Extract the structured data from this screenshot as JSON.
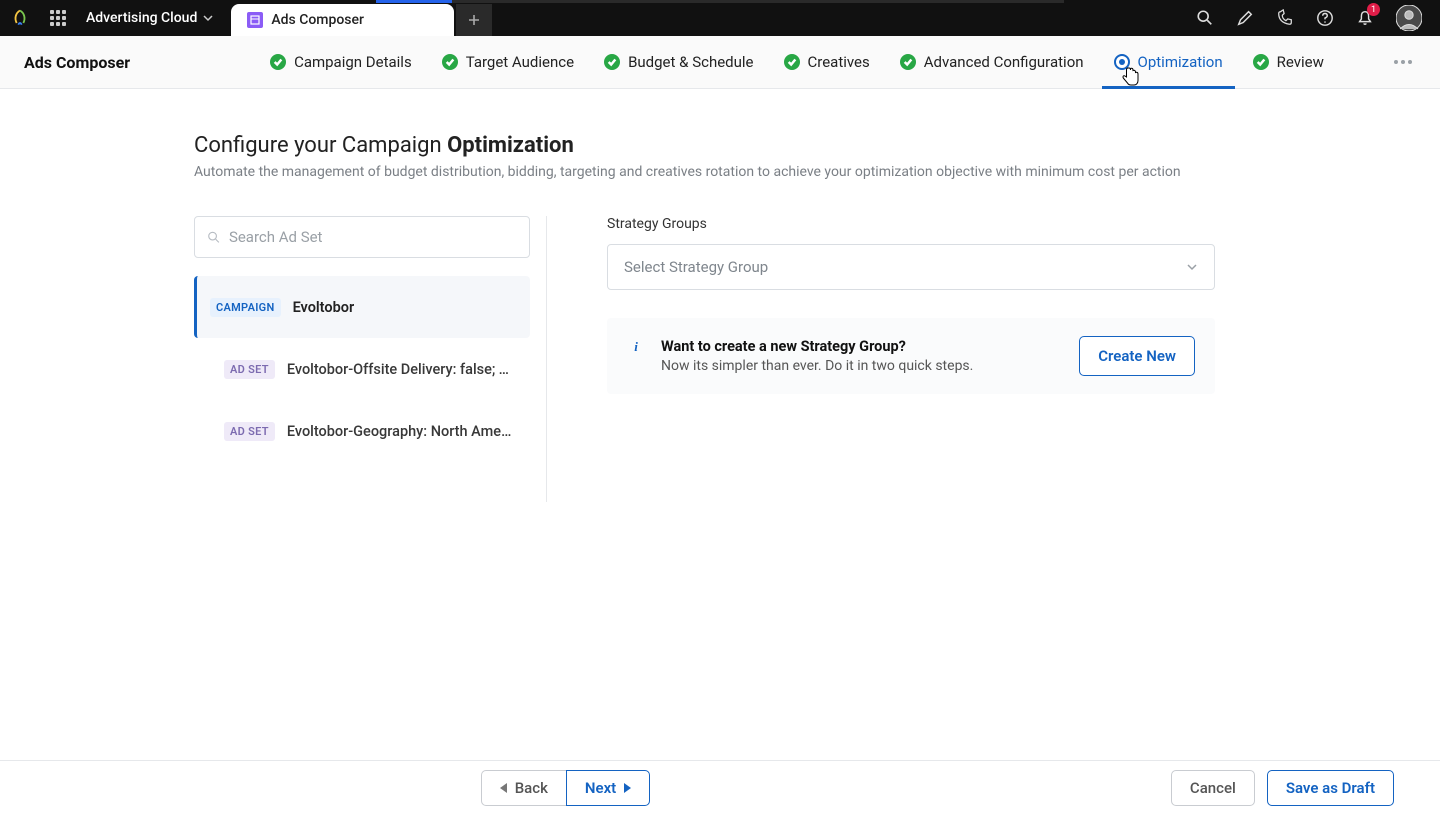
{
  "topbar": {
    "suite": "Advertising Cloud",
    "tab_title": "Ads Composer",
    "notif_count": "1"
  },
  "subheader": {
    "page_title": "Ads Composer",
    "steps": [
      {
        "label": "Campaign Details"
      },
      {
        "label": "Target Audience"
      },
      {
        "label": "Budget & Schedule"
      },
      {
        "label": "Creatives"
      },
      {
        "label": "Advanced Configuration"
      },
      {
        "label": "Optimization"
      },
      {
        "label": "Review"
      }
    ]
  },
  "heading": {
    "prefix": "Configure your Campaign ",
    "strong": "Optimization"
  },
  "subheading": "Automate the management of budget distribution, bidding, targeting and creatives rotation to achieve your optimization objective with minimum cost per action",
  "search_placeholder": "Search Ad Set",
  "tree": {
    "campaign_chip": "CAMPAIGN",
    "adset_chip": "AD SET",
    "campaign_name": "Evoltobor",
    "adset1": "Evoltobor-Offsite Delivery: false; Targe",
    "adset2": "Evoltobor-Geography: North America;"
  },
  "right": {
    "field_label": "Strategy Groups",
    "select_placeholder": "Select Strategy Group",
    "info_title": "Want to create a new Strategy Group?",
    "info_body": "Now its simpler than ever. Do it in two quick steps.",
    "create_btn": "Create New"
  },
  "footer": {
    "back": "Back",
    "next": "Next",
    "cancel": "Cancel",
    "save": "Save as Draft"
  }
}
